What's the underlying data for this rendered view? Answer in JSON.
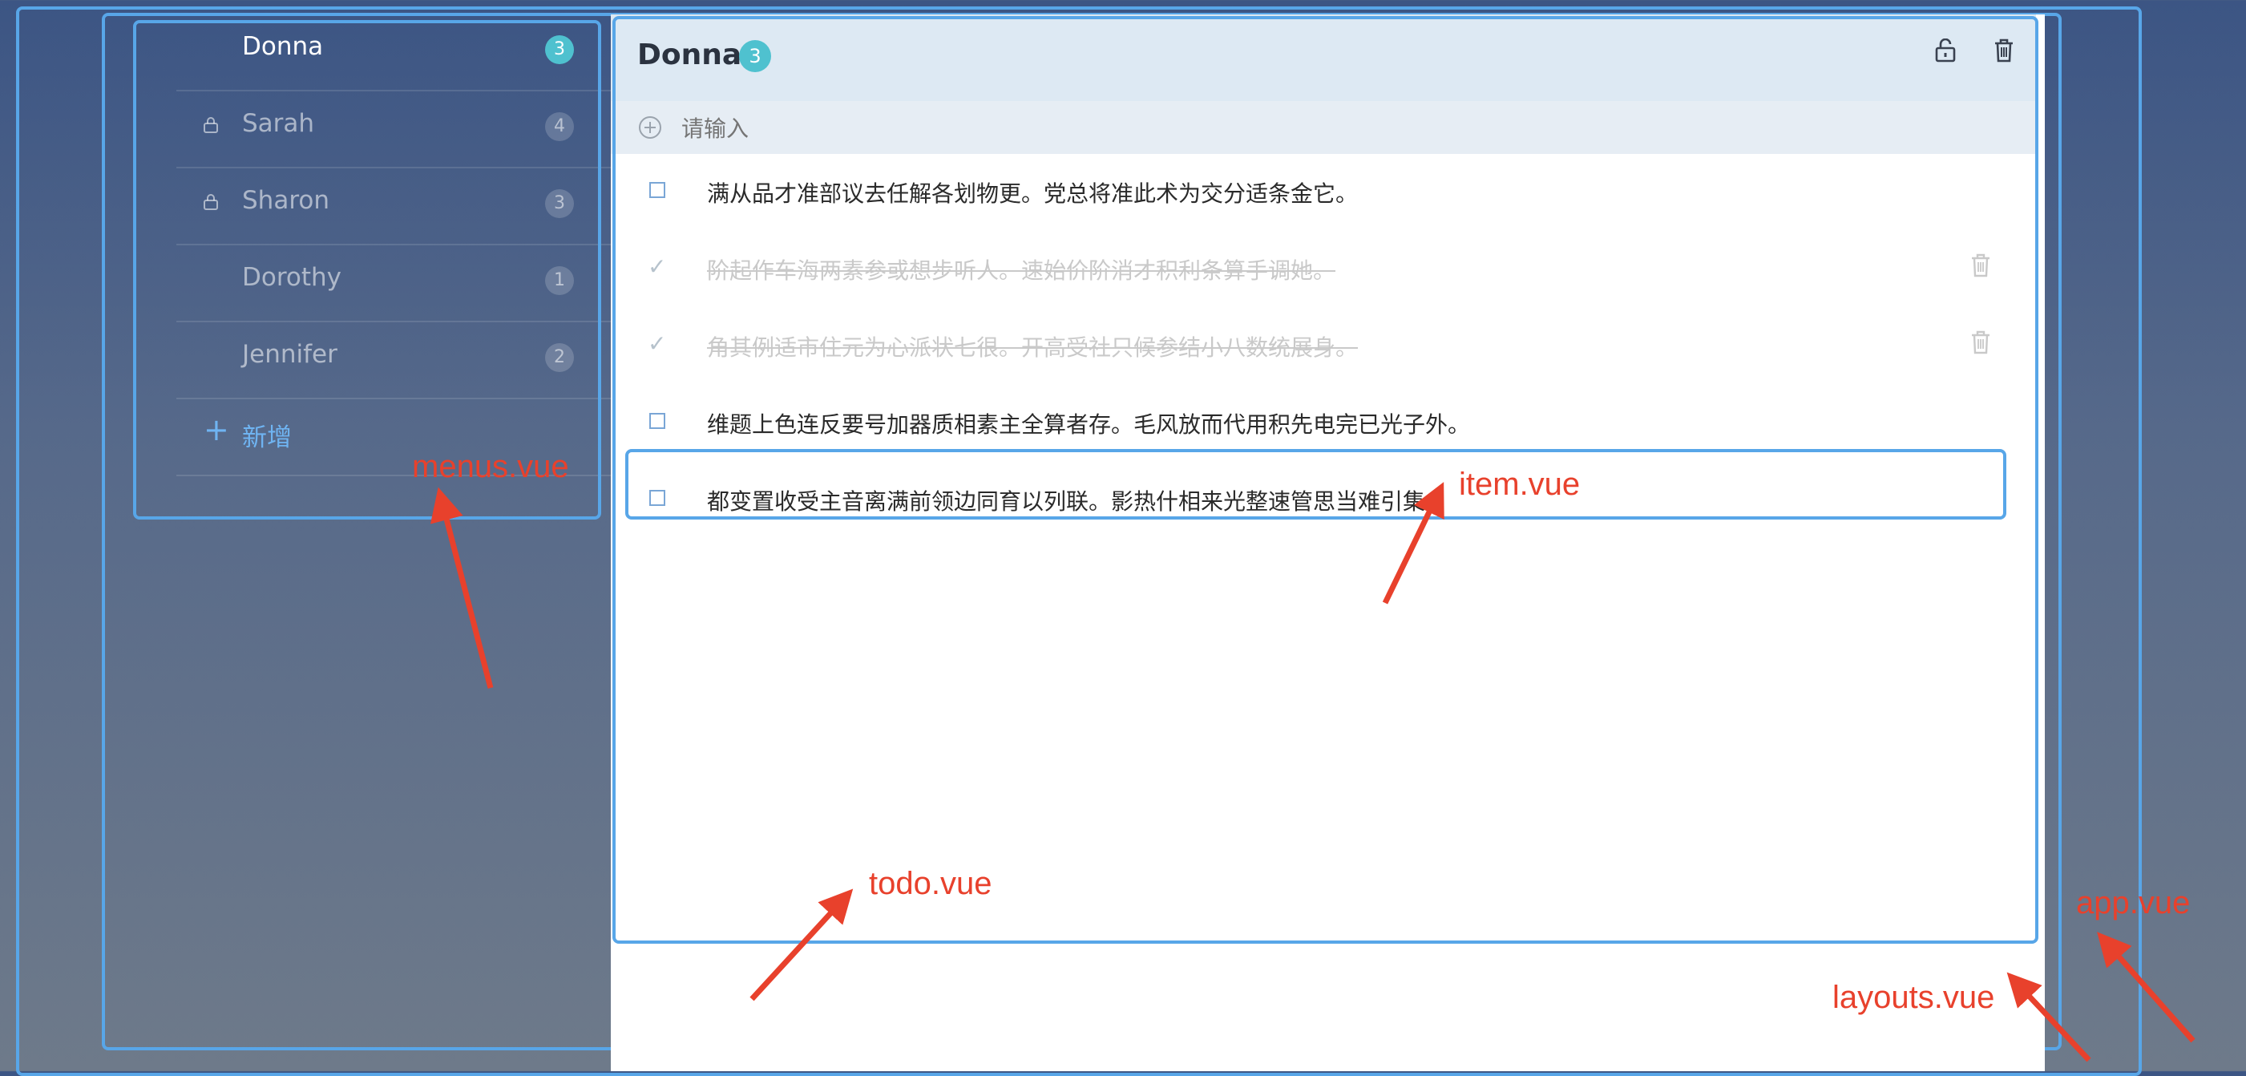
{
  "sidebar": {
    "items": [
      {
        "label": "Donna",
        "count": "3",
        "active": true,
        "locked": false
      },
      {
        "label": "Sarah",
        "count": "4",
        "active": false,
        "locked": true
      },
      {
        "label": "Sharon",
        "count": "3",
        "active": false,
        "locked": true
      },
      {
        "label": "Dorothy",
        "count": "1",
        "active": false,
        "locked": false
      },
      {
        "label": "Jennifer",
        "count": "2",
        "active": false,
        "locked": false
      }
    ],
    "add_label": "新增",
    "add_icon": "plus-icon"
  },
  "header": {
    "title": "Donna",
    "count": "3",
    "unlock_icon": "unlock-icon",
    "delete_icon": "trash-icon"
  },
  "input": {
    "placeholder": "请输入",
    "icon": "plus-circle-icon"
  },
  "todos": [
    {
      "text": "满从品才准部议去任解各划物更。党总将准此术为交分适条金它。",
      "done": false
    },
    {
      "text": "阶起作车海两素参或想步听人。速始价阶消才积利条算手调她。",
      "done": true
    },
    {
      "text": "角其例适市住元为心派状七很。开高受社只候参结小八数统展身。",
      "done": true
    },
    {
      "text": "维题上色连反要号加器质相素主全算者存。毛风放而代用积先电完已光子外。",
      "done": false
    },
    {
      "text": "都变置收受主音离满前领边同育以列联。影热什相来光整速管思当难引集。",
      "done": false
    }
  ],
  "annotations": {
    "menus": "menus.vue",
    "item": "item.vue",
    "todo": "todo.vue",
    "app": "app.vue",
    "layouts": "layouts.vue"
  },
  "colors": {
    "accent": "#4fc1cf",
    "frame": "#58a6e8",
    "annotation": "#e8412c",
    "link": "#6fb4f2"
  }
}
